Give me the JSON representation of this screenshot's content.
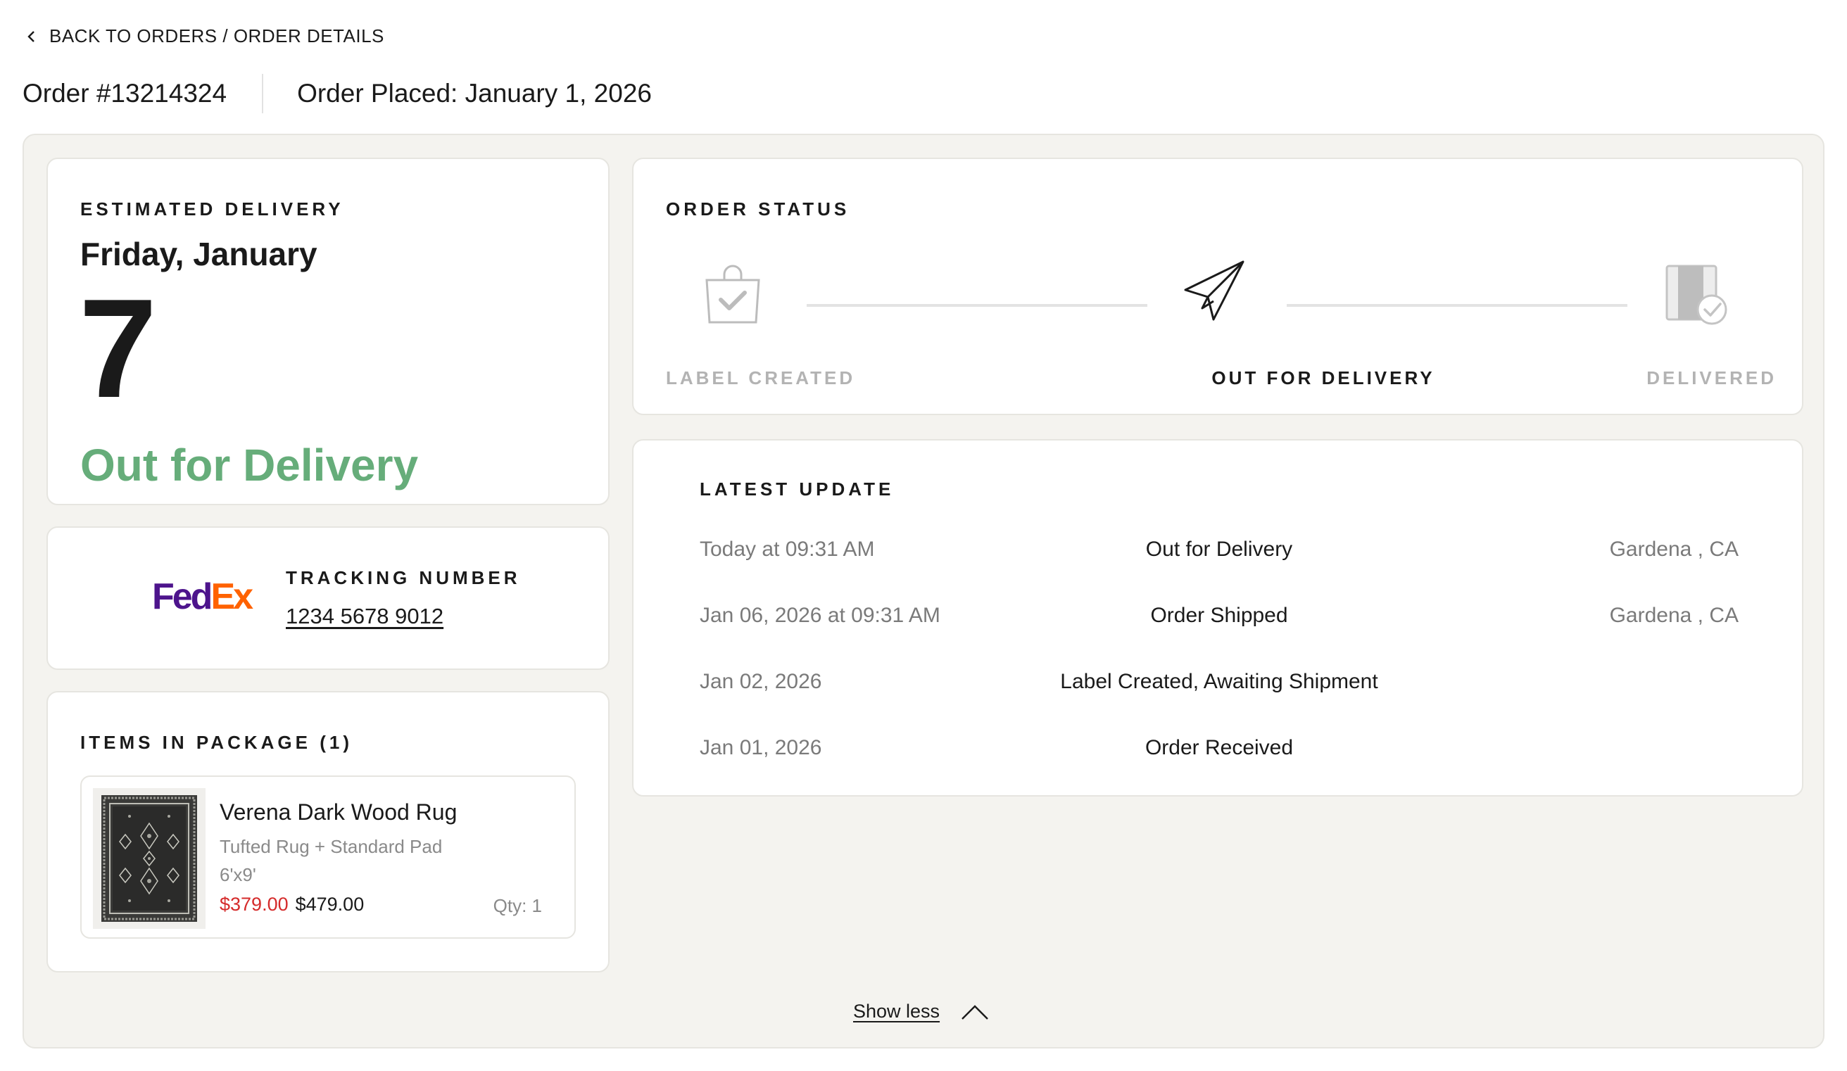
{
  "breadcrumb": {
    "text": "BACK TO ORDERS / ORDER DETAILS"
  },
  "order": {
    "number": "Order #13214324",
    "placed": "Order Placed: January 1, 2026"
  },
  "estimated_delivery": {
    "label": "ESTIMATED DELIVERY",
    "day": "Friday, January",
    "date_number": "7",
    "status": "Out for Delivery",
    "status_color": "#66ad7a"
  },
  "tracking": {
    "carrier_logo": {
      "part1": "Fed",
      "part2": "Ex",
      "color1": "#4d148c",
      "color2": "#ff6200"
    },
    "label": "TRACKING NUMBER",
    "number": "1234 5678 9012"
  },
  "items": {
    "label": "ITEMS IN PACKAGE (1)",
    "list": [
      {
        "name": "Verena Dark Wood Rug",
        "description": "Tufted Rug + Standard Pad",
        "size": "6'x9'",
        "sale_price": "$379.00",
        "original_price": "$479.00",
        "qty": "Qty: 1",
        "image_icon": "rug-thumbnail"
      }
    ]
  },
  "order_status": {
    "label": "ORDER STATUS",
    "steps": [
      {
        "label": "LABEL CREATED",
        "icon": "shopping-bag-check-icon",
        "state": "done"
      },
      {
        "label": "OUT FOR DELIVERY",
        "icon": "paper-plane-icon",
        "state": "current"
      },
      {
        "label": "DELIVERED",
        "icon": "package-check-icon",
        "state": "pending"
      }
    ]
  },
  "latest_update": {
    "label": "LATEST UPDATE",
    "rows": [
      {
        "date": "Today at 09:31 AM",
        "event": "Out for Delivery",
        "location": "Gardena , CA"
      },
      {
        "date": "Jan 06, 2026 at 09:31 AM",
        "event": "Order Shipped",
        "location": "Gardena , CA"
      },
      {
        "date": "Jan 02, 2026",
        "event": "Label Created, Awaiting Shipment",
        "location": ""
      },
      {
        "date": "Jan 01, 2026",
        "event": "Order Received",
        "location": ""
      }
    ]
  },
  "show_less": {
    "label": "Show less",
    "icon": "chevron-up-icon"
  }
}
